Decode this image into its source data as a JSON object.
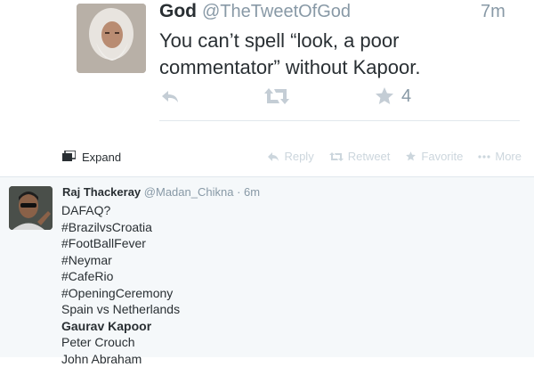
{
  "quoted_tweet": {
    "name": "God",
    "handle": "@TheTweetOfGod",
    "time": "7m",
    "text": "You can’t spell “look, a poor commentator” without Kapoor.",
    "favorite_count": "4",
    "icons": {
      "reply": "reply-icon",
      "retweet": "retweet-icon",
      "favorite": "star-icon"
    }
  },
  "action_bar": {
    "expand": "Expand",
    "reply": "Reply",
    "retweet": "Retweet",
    "favorite": "Favorite",
    "more": "More"
  },
  "tweet": {
    "name": "Raj Thackeray",
    "handle": "@Madan_Chikna",
    "separator": "·",
    "time": "6m",
    "lines": [
      {
        "text": "DAFAQ?",
        "bold": false
      },
      {
        "text": "#BrazilvsCroatia",
        "bold": false
      },
      {
        "text": "#FootBallFever",
        "bold": false
      },
      {
        "text": "#Neymar",
        "bold": false
      },
      {
        "text": "#CafeRio",
        "bold": false
      },
      {
        "text": "#OpeningCeremony",
        "bold": false
      },
      {
        "text": "Spain vs Netherlands",
        "bold": false
      },
      {
        "text": "Gaurav Kapoor",
        "bold": true
      },
      {
        "text": "Peter Crouch",
        "bold": false
      },
      {
        "text": "John Abraham",
        "bold": false
      }
    ]
  },
  "colors": {
    "text": "#292f33",
    "muted": "#8899a6",
    "icon_light": "#c4cdd5",
    "tweet_bg": "#f5f8fa",
    "divider": "#e1e8ed"
  }
}
